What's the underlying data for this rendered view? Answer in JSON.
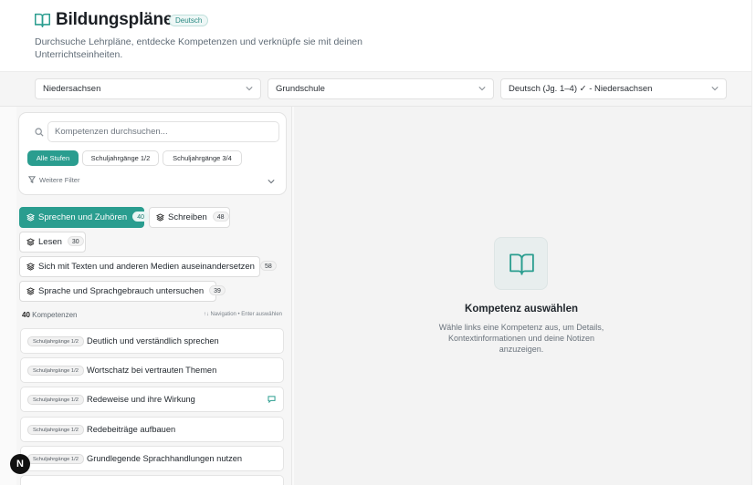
{
  "header": {
    "title": "Bildungspläne",
    "language_badge": "Deutsch",
    "subtitle": "Durchsuche Lehrpläne, entdecke Kompetenzen und verknüpfe sie mit deinen Unterrichtseinheiten.",
    "logo_icon": "book-open-icon"
  },
  "filters": {
    "state": "Niedersachsen",
    "school_type": "Grundschule",
    "curriculum": "Deutsch (Jg. 1–4) ✓ - Niedersachsen"
  },
  "search": {
    "placeholder": "Kompetenzen durchsuchen..."
  },
  "levels": [
    {
      "label": "Alle Stufen",
      "active": true
    },
    {
      "label": "Schuljahrgänge 1/2",
      "active": false
    },
    {
      "label": "Schuljahrgänge 3/4",
      "active": false
    }
  ],
  "more_filters_label": "Weitere Filter",
  "domains": [
    {
      "label": "Sprechen und Zuhören",
      "count": "40",
      "active": true
    },
    {
      "label": "Schreiben",
      "count": "48",
      "active": false
    },
    {
      "label": "Lesen",
      "count": "30",
      "active": false
    },
    {
      "label": "Sich mit Texten und anderen Medien auseinandersetzen",
      "count": "58",
      "active": false
    },
    {
      "label": "Sprache und Sprachgebrauch untersuchen",
      "count": "39",
      "active": false
    }
  ],
  "list_meta": {
    "count": "40",
    "count_label": "Kompetenzen",
    "nav_hint": "↑↓ Navigation • Enter auswählen"
  },
  "competencies": [
    {
      "level": "Schuljahrgänge 1/2",
      "title": "Deutlich und verständlich sprechen",
      "has_note": false
    },
    {
      "level": "Schuljahrgänge 1/2",
      "title": "Wortschatz bei vertrauten Themen",
      "has_note": false
    },
    {
      "level": "Schuljahrgänge 1/2",
      "title": "Redeweise und ihre Wirkung",
      "has_note": true
    },
    {
      "level": "Schuljahrgänge 1/2",
      "title": "Redebeiträge aufbauen",
      "has_note": false
    },
    {
      "level": "Schuljahrgänge 1/2",
      "title": "Grundlegende Sprachhandlungen nutzen",
      "has_note": false
    }
  ],
  "empty_state": {
    "title": "Kompetenz auswählen",
    "text": "Wähle links eine Kompetenz aus, um Details, Kontextinformationen und deine Notizen anzuzeigen.",
    "icon": "book-open-icon"
  },
  "avatar_letter": "N",
  "colors": {
    "accent": "#2a9d8f",
    "background": "#fafafa"
  }
}
